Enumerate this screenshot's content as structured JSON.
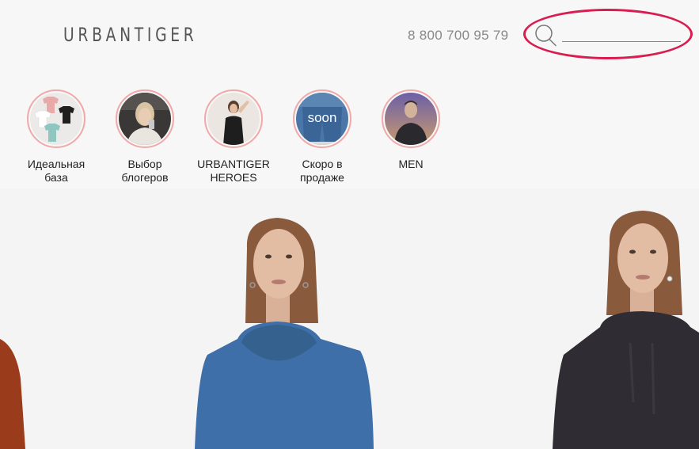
{
  "header": {
    "logo": "URBANTIGER",
    "phone": "8 800 700 95 79",
    "search": {
      "value": "",
      "placeholder": ""
    }
  },
  "stories": [
    {
      "label": "Идеальная\nбаза"
    },
    {
      "label": "Выбор\nблогеров"
    },
    {
      "label": "URBANTIGER\nHEROES"
    },
    {
      "label": "Скоро в\nпродаже",
      "overlay_text": "soon"
    },
    {
      "label": "MEN"
    }
  ],
  "colors": {
    "annotation": "#d81e50",
    "story_ring": "#f0a9a9",
    "hoodie_blue": "#3f6fa8",
    "hoodie_black": "#2f2d33",
    "hoodie_rust": "#9a3b1c"
  }
}
